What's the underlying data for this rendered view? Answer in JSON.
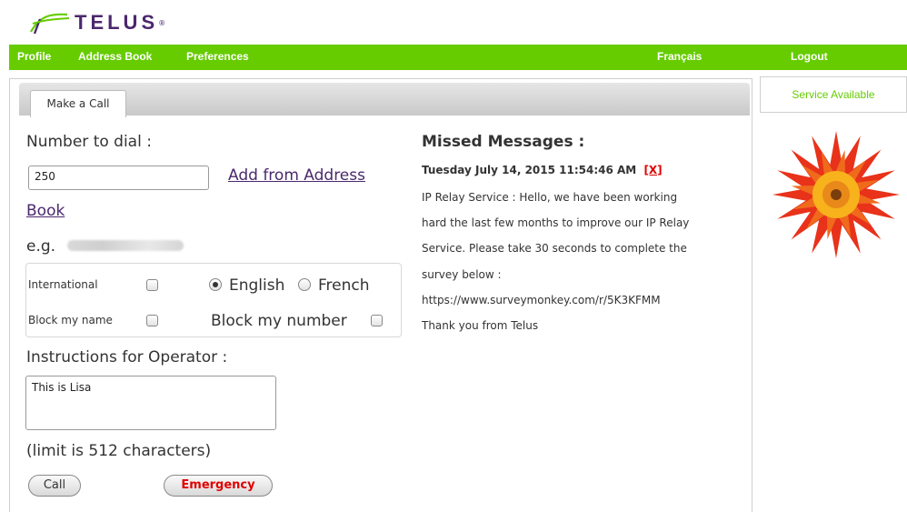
{
  "brand": {
    "name": "TELUS",
    "reg": "®"
  },
  "nav": {
    "profile": "Profile",
    "address_book": "Address Book",
    "preferences": "Preferences",
    "language": "Français",
    "logout": "Logout"
  },
  "tabs": [
    {
      "label": "Make a Call"
    }
  ],
  "form": {
    "number_label": "Number to dial :",
    "number_value": "250",
    "add_from_address_line1": "Add from Address",
    "add_from_address_line2": "Book",
    "example_prefix": "e.g.",
    "international_label": "International",
    "block_name_label": "Block my name",
    "english_label": "English",
    "french_label": "French",
    "block_number_label": "Block my number",
    "language_selected": "English",
    "instructions_label": "Instructions for Operator :",
    "instructions_value": "This is Lisa",
    "limit_text": "(limit is 512 characters)",
    "call_button": "Call",
    "emergency_button": "Emergency"
  },
  "messages": {
    "title": "Missed Messages :",
    "date": "Tuesday July 14, 2015 11:54:46 AM",
    "close": "[X]",
    "lines": [
      "IP Relay Service : Hello, we have been working",
      "hard the last few months to improve our IP Relay",
      "Service. Please take 30 seconds to complete the",
      "survey below :",
      "https://www.surveymonkey.com/r/5K3KFMM",
      "Thank you from Telus"
    ]
  },
  "sidebar": {
    "status": "Service Available"
  },
  "colors": {
    "accent_green": "#66cc00",
    "brand_purple": "#4b286d",
    "emergency_red": "#e00000"
  },
  "icons": [
    "telus-logo-icon",
    "flower-image"
  ]
}
